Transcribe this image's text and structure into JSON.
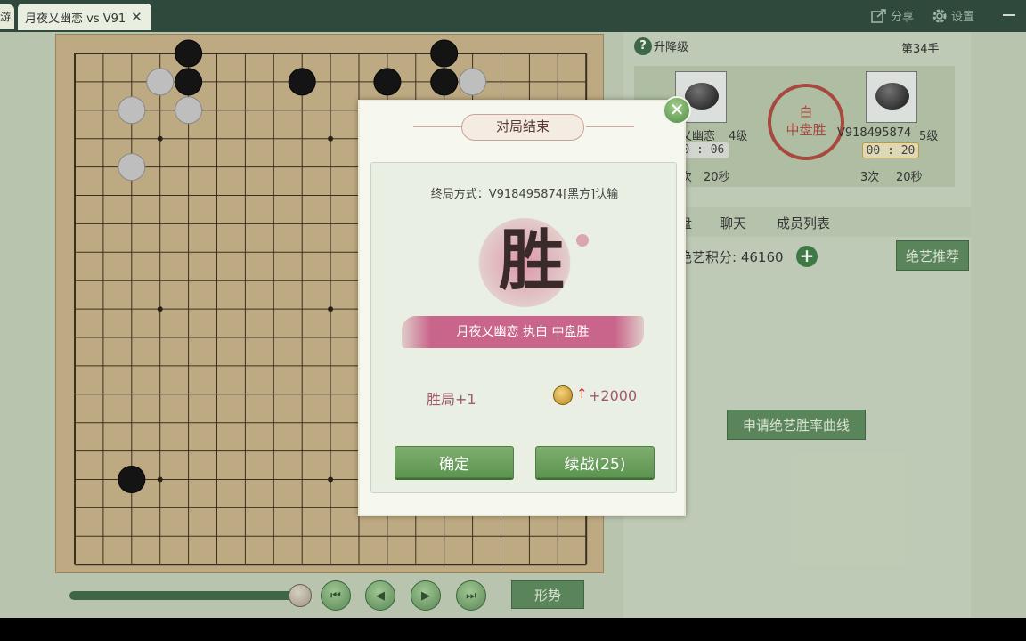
{
  "tabs": {
    "prev_partial": "游",
    "active_title": "月夜乂幽恋 vs V91",
    "close_glyph": "✕"
  },
  "top_actions": {
    "share": "分享",
    "settings": "设置"
  },
  "board": {
    "size": 19,
    "black_stones": [
      [
        4,
        0
      ],
      [
        4,
        1
      ],
      [
        8,
        1
      ],
      [
        13,
        0
      ],
      [
        2,
        15
      ]
    ],
    "white_stones": [
      [
        3,
        1
      ],
      [
        2,
        2
      ],
      [
        4,
        2
      ],
      [
        2,
        4
      ]
    ],
    "hidden_black_near_dialog": [
      [
        11,
        1
      ],
      [
        13,
        1
      ]
    ],
    "hidden_white_near_dialog": [
      [
        14,
        1
      ]
    ]
  },
  "controls": {
    "slider_fraction": 0.98,
    "first": "⏮",
    "prev": "◀",
    "next": "▶",
    "last": "⏭",
    "situation": "形势"
  },
  "right_panel": {
    "help": "?",
    "level_label": "升降级",
    "move_count": "第34手",
    "player_white": {
      "name": "乂幽恋",
      "rank": "4级",
      "time": "00 : 06",
      "byo_count": "次",
      "byo_time": "20秒"
    },
    "player_black": {
      "name": "V918495874",
      "rank": "5级",
      "time": "00 : 20",
      "byo_count": "3次",
      "byo_time": "20秒"
    },
    "seal_line1": "白",
    "seal_line2": "中盘胜",
    "tabs": [
      "盘",
      "聊天",
      "成员列表"
    ],
    "score": "绝艺积分: 46160",
    "plus": "+",
    "recommend": "绝艺推荐",
    "winrate_curve": "申请绝艺胜率曲线"
  },
  "dialog": {
    "title": "对局结束",
    "close": "✕",
    "end_method": "终局方式：V918495874[黑方]认输",
    "win_char": "胜",
    "ribbon_text": "月夜乂幽恋 执白 中盘胜",
    "win_count": "胜局+1",
    "arrow": "↑",
    "coin_gain": "+2000",
    "confirm": "确定",
    "rematch": "续战(25)"
  }
}
